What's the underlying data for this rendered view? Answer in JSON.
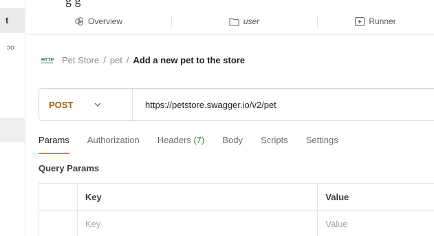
{
  "colors": {
    "method_post": "#a35c00",
    "active_tab_underline": "#ff6c37",
    "header_count": "#2b8a3e"
  },
  "top_clipped_text": "g       g",
  "left_panel": {
    "tab_initial": "t",
    "truncated_text": "ɔo"
  },
  "tabs": [
    {
      "icon": "overview-icon",
      "label": "Overview"
    },
    {
      "icon": "folder-icon",
      "label": "user"
    },
    {
      "icon": "runner-icon",
      "label": "Runner"
    }
  ],
  "breadcrumb": {
    "icon": "http-icon",
    "collection": "Pet Store",
    "separator": "/",
    "folder": "pet",
    "request": "Add a new pet to the store"
  },
  "request": {
    "method": "POST",
    "url": "https://petstore.swagger.io/v2/pet"
  },
  "request_tabs": {
    "params": "Params",
    "authorization": "Authorization",
    "headers": "Headers",
    "headers_count": "(7)",
    "body": "Body",
    "scripts": "Scripts",
    "settings": "Settings"
  },
  "query_params": {
    "title": "Query Params",
    "columns": {
      "key": "Key",
      "value": "Value"
    },
    "placeholder": {
      "key": "Key",
      "value": "Value"
    }
  }
}
